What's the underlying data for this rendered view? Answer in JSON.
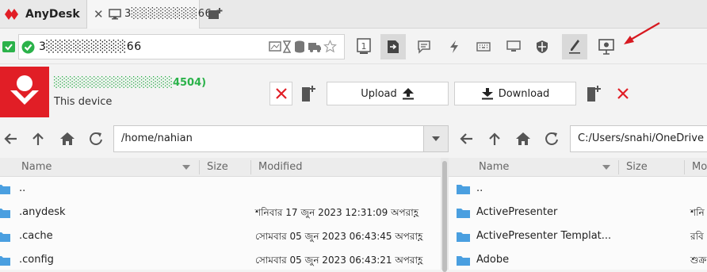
{
  "app": {
    "name": "AnyDesk",
    "brand_color": "#e11e26"
  },
  "tab": {
    "label": "3░░░░░░░░66"
  },
  "address_bar": {
    "value": "3░░░░░░░░░66",
    "status_color": "#2bb24a"
  },
  "toolbar": {
    "icons": [
      "file-manager-icon",
      "transfer-icon",
      "chat-icon",
      "actions-icon",
      "keyboard-icon",
      "display-icon",
      "permissions-icon",
      "draw-icon",
      "whiteboard-icon"
    ]
  },
  "device": {
    "name": "░░░░░░░░░░░░░░░4504)",
    "subtitle": "This device"
  },
  "transfer": {
    "upload_label": "Upload",
    "download_label": "Download"
  },
  "local": {
    "path": "/home/nahian",
    "columns": [
      "Name",
      "Size",
      "Modified"
    ],
    "rows": [
      {
        "name": "..",
        "size": "",
        "modified": ""
      },
      {
        "name": ".anydesk",
        "size": "",
        "modified": "শনিবার 17 জুন 2023 12:31:09 অপরাহ্ণ"
      },
      {
        "name": ".cache",
        "size": "",
        "modified": "সোমবার 05 জুন 2023 06:43:45 অপরাহ্ণ"
      },
      {
        "name": ".config",
        "size": "",
        "modified": "সোমবার 05 জুন 2023 06:43:21 অপরাহ্ণ"
      }
    ]
  },
  "remote": {
    "path": "C:/Users/snahi/OneDrive",
    "columns": [
      "Name",
      "Size",
      "Mo"
    ],
    "rows": [
      {
        "name": "..",
        "modified": ""
      },
      {
        "name": "ActivePresenter",
        "modified": "শনি"
      },
      {
        "name": "ActivePresenter Templat...",
        "modified": "রবি"
      },
      {
        "name": "Adobe",
        "modified": "শুক্র"
      }
    ]
  }
}
